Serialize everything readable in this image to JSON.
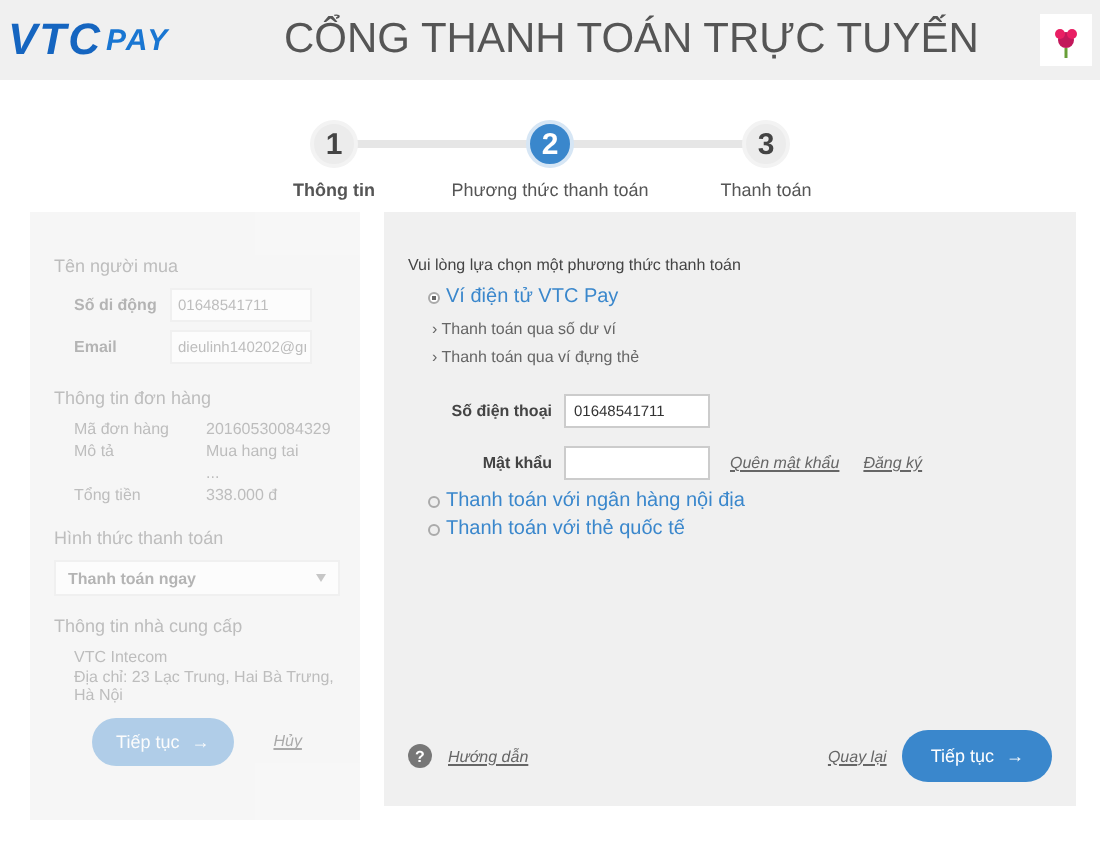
{
  "header": {
    "logo": {
      "part_1": "VTC",
      "part_2": "PAY"
    },
    "title": "CỔNG THANH TOÁN TRỰC TUYẾN"
  },
  "steps": [
    {
      "number": "1",
      "label": "Thông tin",
      "selected": false,
      "done": true
    },
    {
      "number": "2",
      "label": "Phương thức thanh toán",
      "selected": true,
      "done": false
    },
    {
      "number": "3",
      "label": "Thanh toán",
      "selected": false,
      "done": false
    }
  ],
  "order_panel": {
    "disabled": true,
    "buyer": {
      "heading": "Tên người mua",
      "fields": [
        {
          "label": "Số di động",
          "value": "01648541711"
        },
        {
          "label": "Email",
          "value": "dieulinh140202@gı"
        }
      ]
    },
    "order": {
      "heading": "Thông tin đơn hàng",
      "rows": [
        {
          "label": "Mã đơn hàng",
          "value": "20160530084329"
        },
        {
          "label": "Mô tả",
          "value": "Mua hang tai",
          "more": "..."
        },
        {
          "label": "Tổng tiền",
          "value": "338.000 đ"
        }
      ]
    },
    "payment_type": {
      "heading": "Hình thức thanh toán",
      "value": "Thanh toán ngay"
    },
    "provider": {
      "heading": "Thông tin nhà cung cấp",
      "lines": [
        "VTC Intecom",
        "Địa chỉ: 23 Lạc Trung, Hai Bà Trưng, Hà Nội"
      ]
    },
    "continue": "Tiếp tục",
    "arrow": "→",
    "cancel": "Hủy"
  },
  "method_panel": {
    "prompt": "Vui lòng lựa chọn một phương thức thanh toán",
    "methods": [
      {
        "label": "Ví điện tử VTC Pay",
        "selected": true,
        "sub_options": [
          "Thanh toán qua số dư ví",
          "Thanh toán qua ví đựng thẻ"
        ],
        "bullet": "›",
        "fields": [
          {
            "label": "Số điện thoại",
            "value": "01648541711"
          },
          {
            "label": "Mật khẩu"
          }
        ],
        "links": [
          "Quên mật khẩu",
          "Đăng ký"
        ]
      },
      {
        "label": "Thanh toán với ngân hàng nội địa",
        "selected": false
      },
      {
        "label": "Thanh toán với thẻ quốc tế",
        "selected": false
      }
    ],
    "help": "Hướng dẫn",
    "help_icon": "?",
    "back": "Quay lại",
    "continue": "Tiếp tục",
    "arrow": "→"
  }
}
